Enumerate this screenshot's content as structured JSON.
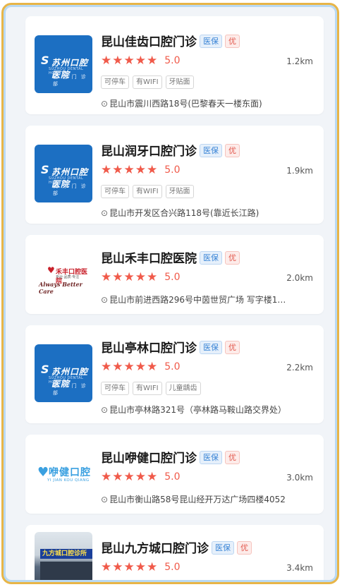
{
  "colors": {
    "frame_gold": "#e8b547",
    "frame_blue": "#b9d9f3",
    "star": "#f05a4a",
    "badge_blue": "#3a84d6",
    "badge_red": "#e2584d"
  },
  "badges": {
    "insurance": "医保",
    "preferred": "优"
  },
  "clinics": [
    {
      "name": "昆山佳齿口腔门诊",
      "rating": "5.0",
      "stars": 5,
      "distance": "1.2km",
      "tags": [
        "可停车",
        "有WIFI",
        "牙贴面"
      ],
      "address": "昆山市震川西路18号(巴黎春天一楼东面)",
      "image": {
        "type": "logo",
        "line1": "苏州口腔医院",
        "line2": "SUZHOU DENTAL HOSPITAL",
        "line3": "佳 齿 门 诊 部"
      }
    },
    {
      "name": "昆山润牙口腔门诊",
      "rating": "5.0",
      "stars": 5,
      "distance": "1.9km",
      "tags": [
        "可停车",
        "有WIFI",
        "牙贴面"
      ],
      "address": "昆山市开发区合兴路118号(靠近长江路)",
      "image": {
        "type": "logo",
        "line1": "苏州口腔医院",
        "line2": "SUZHOU DENTAL HOSPITAL",
        "line3": "润 牙 门 诊 部"
      }
    },
    {
      "name": "昆山禾丰口腔医院",
      "rating": "5.0",
      "stars": 5,
      "distance": "2.0km",
      "tags": [],
      "address": "昆山市前进西路296号中茵世贸广场 写字楼1…",
      "image": {
        "type": "hefeng",
        "title": "禾丰口腔医院",
        "sub": "专业·品质·专注",
        "script": "Always Better Care"
      }
    },
    {
      "name": "昆山亭林口腔门诊",
      "rating": "5.0",
      "stars": 5,
      "distance": "2.2km",
      "tags": [
        "可停车",
        "有WIFI",
        "儿童龋齿"
      ],
      "address": "昆山市亭林路321号（亭林路马鞍山路交界处）",
      "image": {
        "type": "logo",
        "line1": "苏州口腔医院",
        "line2": "SUZHOU DENTAL HOSPITAL",
        "line3": "亭 林 门 诊 部"
      }
    },
    {
      "name": "昆山咿健口腔门诊",
      "rating": "5.0",
      "stars": 5,
      "distance": "3.0km",
      "tags": [],
      "address": "昆山市衡山路58号昆山经开万达广场四楼4052",
      "image": {
        "type": "yijian",
        "title": "咿健口腔",
        "sub": "YI JIAN KOU QIANG"
      }
    },
    {
      "name": "昆山九方城口腔门诊",
      "rating": "5.0",
      "stars": 5,
      "distance": "3.4km",
      "tags": [],
      "address": "",
      "image": {
        "type": "photo",
        "sign": "九方城口腔诊所"
      }
    }
  ]
}
